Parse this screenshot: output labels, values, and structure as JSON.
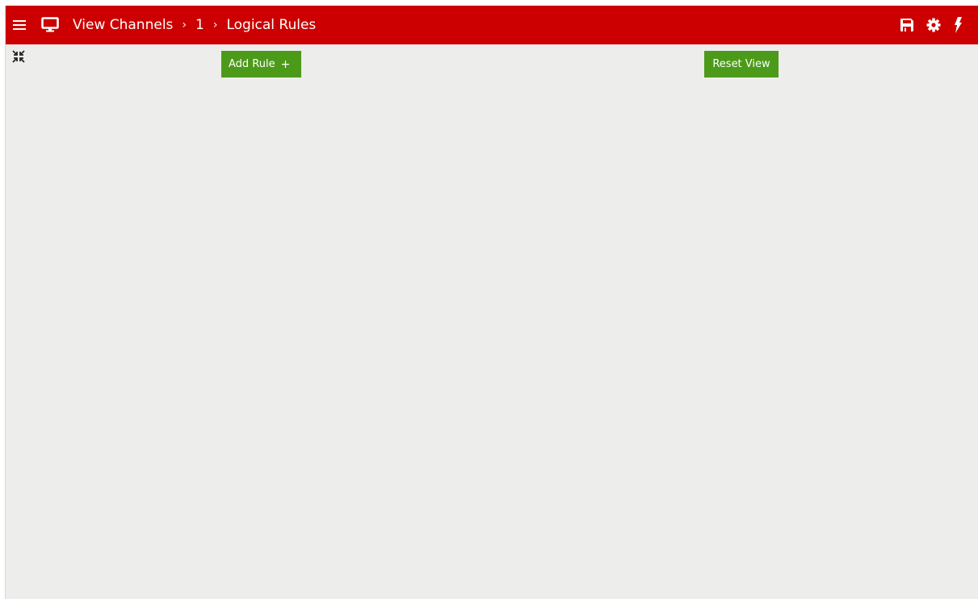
{
  "topbar": {
    "background": "#cc0000",
    "menu_icon": "hamburger-menu-icon",
    "channel_icon": "monitor-icon",
    "breadcrumb": [
      {
        "label": "View Channels"
      },
      {
        "label": "1"
      },
      {
        "label": "Logical Rules"
      }
    ],
    "separator": "›",
    "actions": [
      {
        "icon": "save-icon"
      },
      {
        "icon": "gear-icon"
      },
      {
        "icon": "lightning-icon"
      }
    ]
  },
  "canvas": {
    "background": "#ededeb",
    "collapse_icon": "compress-icon",
    "add_rule_button": {
      "label": "Add Rule",
      "icon": "+",
      "color": "#4c9a1a"
    },
    "reset_view_button": {
      "label": "Reset View",
      "color": "#4c9a1a"
    }
  }
}
